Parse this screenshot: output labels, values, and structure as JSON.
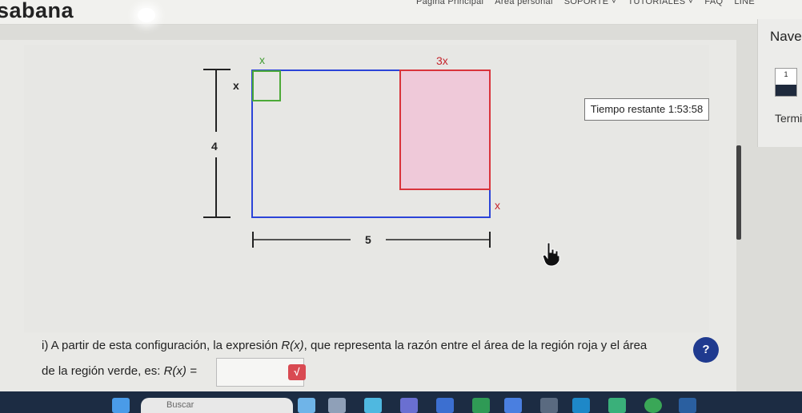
{
  "header": {
    "brand": "sabana",
    "nav": [
      "Página Principal",
      "Área personal",
      "SOPORTE ˅",
      "TUTORIALES ˅",
      "FAQ",
      "LÍNE"
    ]
  },
  "side_nav": {
    "title": "Naveg",
    "question_number": "1",
    "finish_label": "Termi"
  },
  "timer": {
    "text": "Tiempo restante 1:53:58"
  },
  "diagram": {
    "labels": {
      "x_top_green": "x",
      "x_left_green": "x",
      "three_x": "3x",
      "four": "4",
      "x_right": "x",
      "five": "5"
    },
    "colors": {
      "outer": "#2b44d8",
      "green": "#4caa38",
      "red": "#d9333b",
      "red_fill": "#efc9d9",
      "green_label": "#3f9b30",
      "red_label": "#c4242c"
    }
  },
  "question": {
    "line1_prefix": "i) A partir de esta configuración, la expresión ",
    "line1_expr": "R(x)",
    "line1_suffix": ", que representa la razón entre el área de la región roja y el área",
    "line2_prefix": "de la región verde, es: ",
    "line2_expr": "R(x) =",
    "answer_value": "",
    "math_button": "√",
    "help_button": "?"
  },
  "taskbar": {
    "search_placeholder": "Buscar"
  }
}
